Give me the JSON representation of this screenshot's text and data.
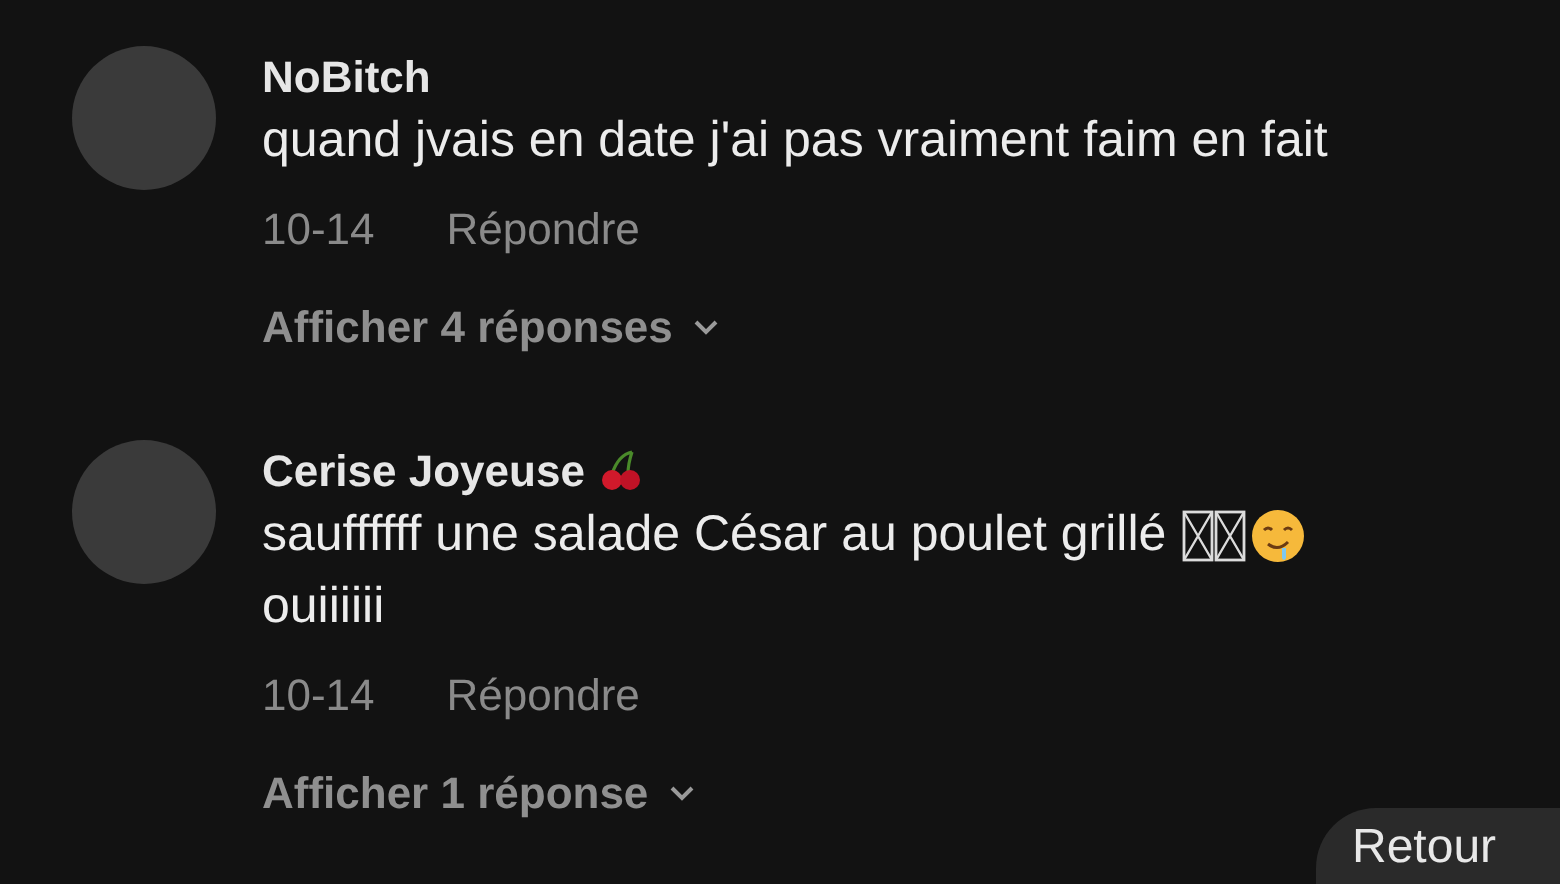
{
  "comments": [
    {
      "author": "NoBitch",
      "author_emoji": false,
      "lines": [
        "quand jvais en date j'ai pas vraiment faim en fait"
      ],
      "trailing_icons": false,
      "date": "10-14",
      "reply": "Répondre",
      "show_replies": "Afficher 4 réponses"
    },
    {
      "author": "Cerise Joyeuse",
      "author_emoji": true,
      "lines": [
        "sauffffff une salade César au poulet grillé",
        "ouiiiiii"
      ],
      "trailing_icons": true,
      "date": "10-14",
      "reply": "Répondre",
      "show_replies": "Afficher 1 réponse"
    }
  ],
  "back_button": {
    "label": "Retour"
  }
}
